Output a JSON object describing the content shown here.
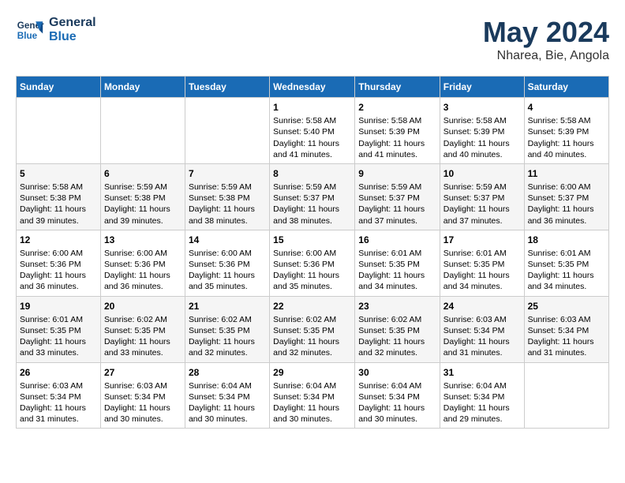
{
  "header": {
    "logo_line1": "General",
    "logo_line2": "Blue",
    "month": "May 2024",
    "location": "Nharea, Bie, Angola"
  },
  "weekdays": [
    "Sunday",
    "Monday",
    "Tuesday",
    "Wednesday",
    "Thursday",
    "Friday",
    "Saturday"
  ],
  "weeks": [
    [
      {
        "day": "",
        "info": ""
      },
      {
        "day": "",
        "info": ""
      },
      {
        "day": "",
        "info": ""
      },
      {
        "day": "1",
        "info": "Sunrise: 5:58 AM\nSunset: 5:40 PM\nDaylight: 11 hours\nand 41 minutes."
      },
      {
        "day": "2",
        "info": "Sunrise: 5:58 AM\nSunset: 5:39 PM\nDaylight: 11 hours\nand 41 minutes."
      },
      {
        "day": "3",
        "info": "Sunrise: 5:58 AM\nSunset: 5:39 PM\nDaylight: 11 hours\nand 40 minutes."
      },
      {
        "day": "4",
        "info": "Sunrise: 5:58 AM\nSunset: 5:39 PM\nDaylight: 11 hours\nand 40 minutes."
      }
    ],
    [
      {
        "day": "5",
        "info": "Sunrise: 5:58 AM\nSunset: 5:38 PM\nDaylight: 11 hours\nand 39 minutes."
      },
      {
        "day": "6",
        "info": "Sunrise: 5:59 AM\nSunset: 5:38 PM\nDaylight: 11 hours\nand 39 minutes."
      },
      {
        "day": "7",
        "info": "Sunrise: 5:59 AM\nSunset: 5:38 PM\nDaylight: 11 hours\nand 38 minutes."
      },
      {
        "day": "8",
        "info": "Sunrise: 5:59 AM\nSunset: 5:37 PM\nDaylight: 11 hours\nand 38 minutes."
      },
      {
        "day": "9",
        "info": "Sunrise: 5:59 AM\nSunset: 5:37 PM\nDaylight: 11 hours\nand 37 minutes."
      },
      {
        "day": "10",
        "info": "Sunrise: 5:59 AM\nSunset: 5:37 PM\nDaylight: 11 hours\nand 37 minutes."
      },
      {
        "day": "11",
        "info": "Sunrise: 6:00 AM\nSunset: 5:37 PM\nDaylight: 11 hours\nand 36 minutes."
      }
    ],
    [
      {
        "day": "12",
        "info": "Sunrise: 6:00 AM\nSunset: 5:36 PM\nDaylight: 11 hours\nand 36 minutes."
      },
      {
        "day": "13",
        "info": "Sunrise: 6:00 AM\nSunset: 5:36 PM\nDaylight: 11 hours\nand 36 minutes."
      },
      {
        "day": "14",
        "info": "Sunrise: 6:00 AM\nSunset: 5:36 PM\nDaylight: 11 hours\nand 35 minutes."
      },
      {
        "day": "15",
        "info": "Sunrise: 6:00 AM\nSunset: 5:36 PM\nDaylight: 11 hours\nand 35 minutes."
      },
      {
        "day": "16",
        "info": "Sunrise: 6:01 AM\nSunset: 5:35 PM\nDaylight: 11 hours\nand 34 minutes."
      },
      {
        "day": "17",
        "info": "Sunrise: 6:01 AM\nSunset: 5:35 PM\nDaylight: 11 hours\nand 34 minutes."
      },
      {
        "day": "18",
        "info": "Sunrise: 6:01 AM\nSunset: 5:35 PM\nDaylight: 11 hours\nand 34 minutes."
      }
    ],
    [
      {
        "day": "19",
        "info": "Sunrise: 6:01 AM\nSunset: 5:35 PM\nDaylight: 11 hours\nand 33 minutes."
      },
      {
        "day": "20",
        "info": "Sunrise: 6:02 AM\nSunset: 5:35 PM\nDaylight: 11 hours\nand 33 minutes."
      },
      {
        "day": "21",
        "info": "Sunrise: 6:02 AM\nSunset: 5:35 PM\nDaylight: 11 hours\nand 32 minutes."
      },
      {
        "day": "22",
        "info": "Sunrise: 6:02 AM\nSunset: 5:35 PM\nDaylight: 11 hours\nand 32 minutes."
      },
      {
        "day": "23",
        "info": "Sunrise: 6:02 AM\nSunset: 5:35 PM\nDaylight: 11 hours\nand 32 minutes."
      },
      {
        "day": "24",
        "info": "Sunrise: 6:03 AM\nSunset: 5:34 PM\nDaylight: 11 hours\nand 31 minutes."
      },
      {
        "day": "25",
        "info": "Sunrise: 6:03 AM\nSunset: 5:34 PM\nDaylight: 11 hours\nand 31 minutes."
      }
    ],
    [
      {
        "day": "26",
        "info": "Sunrise: 6:03 AM\nSunset: 5:34 PM\nDaylight: 11 hours\nand 31 minutes."
      },
      {
        "day": "27",
        "info": "Sunrise: 6:03 AM\nSunset: 5:34 PM\nDaylight: 11 hours\nand 30 minutes."
      },
      {
        "day": "28",
        "info": "Sunrise: 6:04 AM\nSunset: 5:34 PM\nDaylight: 11 hours\nand 30 minutes."
      },
      {
        "day": "29",
        "info": "Sunrise: 6:04 AM\nSunset: 5:34 PM\nDaylight: 11 hours\nand 30 minutes."
      },
      {
        "day": "30",
        "info": "Sunrise: 6:04 AM\nSunset: 5:34 PM\nDaylight: 11 hours\nand 30 minutes."
      },
      {
        "day": "31",
        "info": "Sunrise: 6:04 AM\nSunset: 5:34 PM\nDaylight: 11 hours\nand 29 minutes."
      },
      {
        "day": "",
        "info": ""
      }
    ]
  ]
}
